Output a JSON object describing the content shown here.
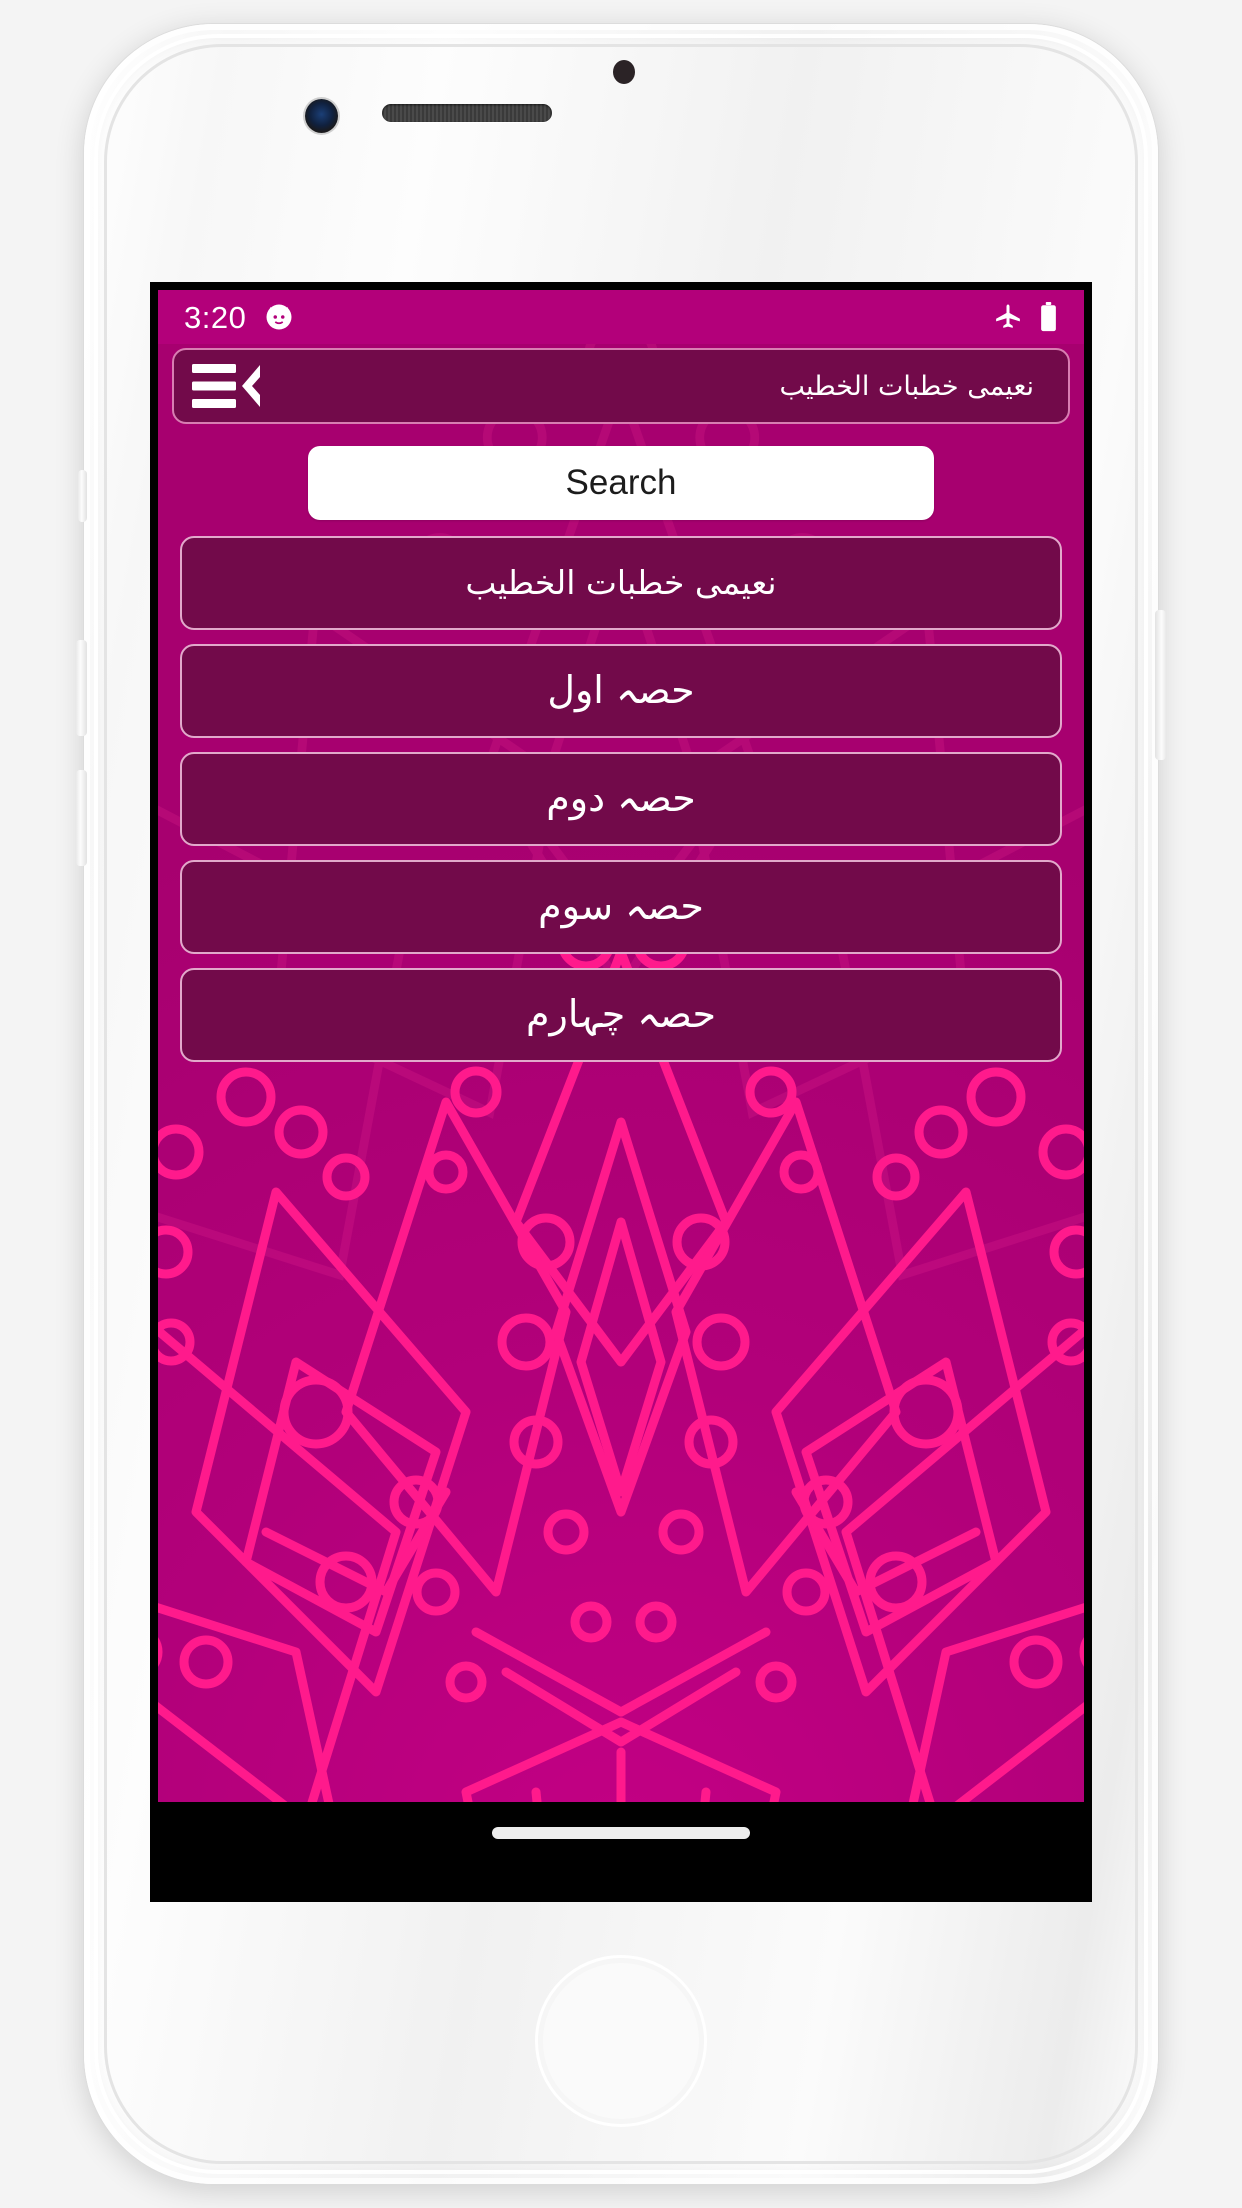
{
  "device": {
    "type": "smartphone-mockup",
    "frame_color": "#f4f4f4"
  },
  "status_bar": {
    "time": "3:20",
    "icons": [
      "cat-face-icon",
      "airplane-mode-icon",
      "battery-full-icon"
    ],
    "background": "#b3007a",
    "foreground": "#ffffff"
  },
  "app_bar": {
    "title": "نعیمی خطبات الخطیب",
    "menu_icon": "hamburger-back-icon",
    "background": "#720A4A",
    "border": "#d87eb2"
  },
  "search": {
    "placeholder": "Search",
    "value": "Search"
  },
  "list": {
    "items": [
      {
        "label": "نعیمی خطبات الخطیب",
        "size": "small"
      },
      {
        "label": "حصہ اول",
        "size": "normal"
      },
      {
        "label": "حصہ دوم",
        "size": "normal"
      },
      {
        "label": "حصہ سوم",
        "size": "normal"
      },
      {
        "label": "حصہ چہارم",
        "size": "normal"
      }
    ]
  },
  "theme": {
    "accent_magenta": "#b5007a",
    "deep_maroon": "#720A4A",
    "pattern_pink": "#ff1a8c",
    "white": "#ffffff"
  },
  "navigation": {
    "home_indicator": true
  }
}
